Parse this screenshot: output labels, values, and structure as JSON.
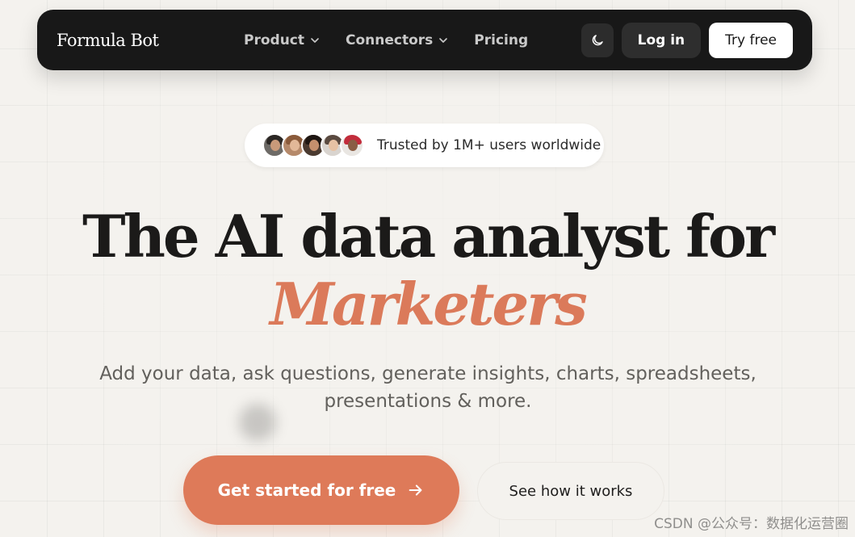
{
  "nav": {
    "brand": "Formula Bot",
    "menu": [
      {
        "label": "Product",
        "has_dropdown": true
      },
      {
        "label": "Connectors",
        "has_dropdown": true
      },
      {
        "label": "Pricing",
        "has_dropdown": false
      }
    ],
    "theme_icon": "moon-icon",
    "login_label": "Log in",
    "try_label": "Try free"
  },
  "trust": {
    "text": "Trusted by 1M+ users worldwide",
    "avatar_count": 5
  },
  "hero": {
    "headline": "The AI data analyst for",
    "highlight": "Marketers",
    "subtitle_line1": "Add your data, ask questions, generate insights, charts, spreadsheets,",
    "subtitle_line2": "presentations & more."
  },
  "cta": {
    "primary_label": "Get started for free",
    "primary_icon": "arrow-right-icon",
    "secondary_label": "See how it works"
  },
  "watermark": "CSDN @公众号：数据化运营圈",
  "colors": {
    "accent": "#de7a59",
    "nav_bg": "#181818",
    "page_bg": "#f4f2ee"
  }
}
